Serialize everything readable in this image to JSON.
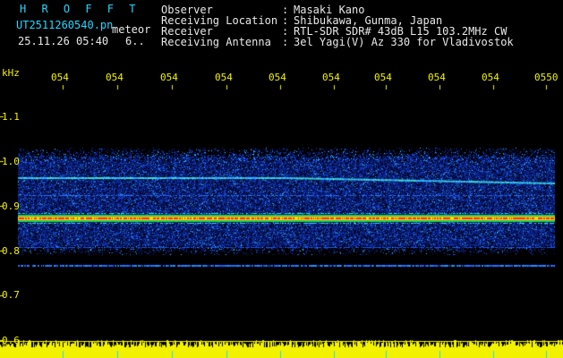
{
  "header": {
    "logo_text": "H R O F F T",
    "filename": "UT2511260540.pn",
    "mode": "meteor",
    "datetime": "25.11.26 05:40",
    "extra": "6..",
    "fields": [
      {
        "label": "Observer",
        "value": "Masaki Kano"
      },
      {
        "label": "Receiving Location",
        "value": "Shibukawa, Gunma, Japan"
      },
      {
        "label": "Receiver",
        "value": "RTL-SDR SDR# 43dB L15 103.2MHz CW"
      },
      {
        "label": "Receiving Antenna",
        "value": "3el Yagi(V) Az 330 for Vladivostok"
      }
    ]
  },
  "plot": {
    "y_unit": "kHz",
    "y_ticks": [
      "1.1",
      "1.0",
      "0.9",
      "0.8",
      "0.7",
      "0.6"
    ],
    "x_ticks": [
      "054",
      "054",
      "054",
      "054",
      "054",
      "054",
      "054",
      "054",
      "054",
      "0550"
    ]
  },
  "colors": {
    "background": "#000000",
    "text_cyan": "#22d8ff",
    "text_white": "#e8e8e8",
    "axis_yellow": "#f2f200",
    "spectrum_blue": "#0a2aa0",
    "signal_red": "#ff2a2a"
  }
}
